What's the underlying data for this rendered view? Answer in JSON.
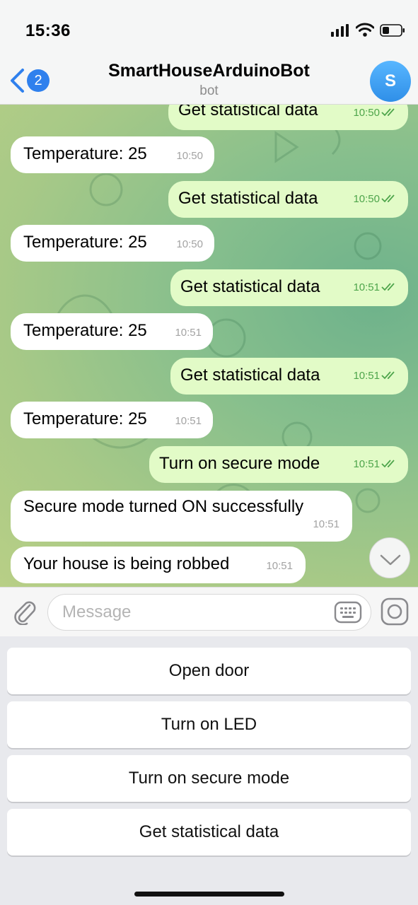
{
  "status": {
    "time": "15:36"
  },
  "header": {
    "back_count": "2",
    "title": "SmartHouseArduinoBot",
    "subtitle": "bot",
    "avatar_letter": "S"
  },
  "messages": [
    {
      "dir": "out",
      "text": "Get statistical data",
      "time": "10:50"
    },
    {
      "dir": "in",
      "text": "Temperature: 25",
      "time": "10:50"
    },
    {
      "dir": "out",
      "text": "Get statistical data",
      "time": "10:50"
    },
    {
      "dir": "in",
      "text": "Temperature: 25",
      "time": "10:50"
    },
    {
      "dir": "out",
      "text": "Get statistical data",
      "time": "10:51"
    },
    {
      "dir": "in",
      "text": "Temperature: 25",
      "time": "10:51"
    },
    {
      "dir": "out",
      "text": "Get statistical data",
      "time": "10:51"
    },
    {
      "dir": "in",
      "text": "Temperature: 25",
      "time": "10:51"
    },
    {
      "dir": "out",
      "text": "Turn on secure mode",
      "time": "10:51"
    },
    {
      "dir": "in",
      "text": "Secure mode turned ON successfully",
      "time": "10:51"
    },
    {
      "dir": "in",
      "text": "Your house is being robbed",
      "time": "10:51"
    }
  ],
  "composer": {
    "placeholder": "Message"
  },
  "keyboard": [
    "Open door",
    "Turn on LED",
    "Turn on secure mode",
    "Get statistical data"
  ],
  "colors": {
    "accent": "#2f80ed",
    "outgoing_bubble": "#e2fbc7",
    "incoming_bubble": "#ffffff",
    "read_ticks": "#4ea54b"
  }
}
